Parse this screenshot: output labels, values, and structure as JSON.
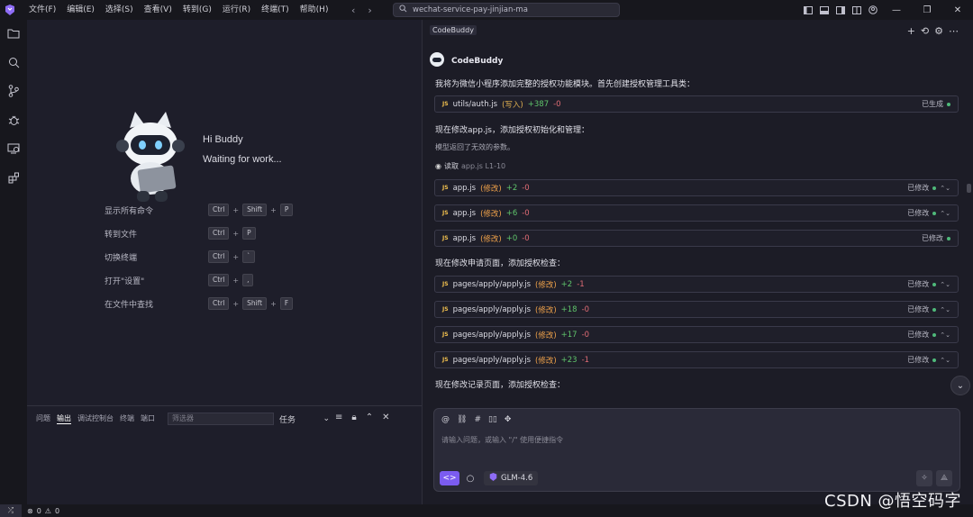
{
  "titlebar": {
    "menus": [
      "文件(F)",
      "编辑(E)",
      "选择(S)",
      "查看(V)",
      "转到(G)",
      "运行(R)",
      "终端(T)",
      "帮助(H)"
    ],
    "search_text": "wechat-service-pay-jinjian-ma"
  },
  "welcome": {
    "greeting": "Hi Buddy",
    "status": "Waiting for work...",
    "shortcuts": [
      {
        "label": "显示所有命令",
        "keys": [
          "Ctrl",
          "Shift",
          "P"
        ]
      },
      {
        "label": "转到文件",
        "keys": [
          "Ctrl",
          "P"
        ]
      },
      {
        "label": "切换终端",
        "keys": [
          "Ctrl",
          "`"
        ]
      },
      {
        "label": "打开\"设置\"",
        "keys": [
          "Ctrl",
          ","
        ]
      },
      {
        "label": "在文件中查找",
        "keys": [
          "Ctrl",
          "Shift",
          "F"
        ]
      }
    ]
  },
  "panel": {
    "tabs": [
      "问题",
      "输出",
      "调试控制台",
      "终端",
      "端口"
    ],
    "active_tab": "输出",
    "filter_placeholder": "筛选器",
    "task_select": "任务"
  },
  "status": {
    "errors": "0",
    "warnings": "0"
  },
  "chat": {
    "tab_label": "CodeBuddy",
    "assistant_name": "CodeBuddy",
    "msg1": "我将为微信小程序添加完整的授权功能模块。首先创建授权管理工具类：",
    "msg2": "现在修改app.js，添加授权初始化和管理：",
    "note1": "模型返回了无效的参数。",
    "read_label": "读取",
    "read_ref": "app.js  L1-10",
    "msg3": "现在修改申请页面，添加授权检查：",
    "msg4": "现在修改记录页面，添加授权检查：",
    "cards": [
      {
        "file": "utils/auth.js",
        "tag": "(写入)",
        "add": "+387",
        "del": "-0",
        "status": "已生成"
      },
      {
        "file": "app.js",
        "tag": "(修改)",
        "add": "+2",
        "del": "-0",
        "status": "已修改"
      },
      {
        "file": "app.js",
        "tag": "(修改)",
        "add": "+6",
        "del": "-0",
        "status": "已修改"
      },
      {
        "file": "app.js",
        "tag": "(修改)",
        "add": "+0",
        "del": "-0",
        "status": "已修改"
      },
      {
        "file": "pages/apply/apply.js",
        "tag": "(修改)",
        "add": "+2",
        "del": "-1",
        "status": "已修改"
      },
      {
        "file": "pages/apply/apply.js",
        "tag": "(修改)",
        "add": "+18",
        "del": "-0",
        "status": "已修改"
      },
      {
        "file": "pages/apply/apply.js",
        "tag": "(修改)",
        "add": "+17",
        "del": "-0",
        "status": "已修改"
      },
      {
        "file": "pages/apply/apply.js",
        "tag": "(修改)",
        "add": "+23",
        "del": "-1",
        "status": "已修改"
      }
    ],
    "input_placeholder": "请输入问题，或输入 \"/\" 使用便捷指令",
    "model": "GLM-4.6"
  },
  "watermark": "CSDN @悟空码字",
  "colors": {
    "accent": "#7b5cf0",
    "add": "#5fc46b",
    "del": "#e06c75",
    "modify": "#f0a24a",
    "status_dot": "#4fb97a"
  }
}
